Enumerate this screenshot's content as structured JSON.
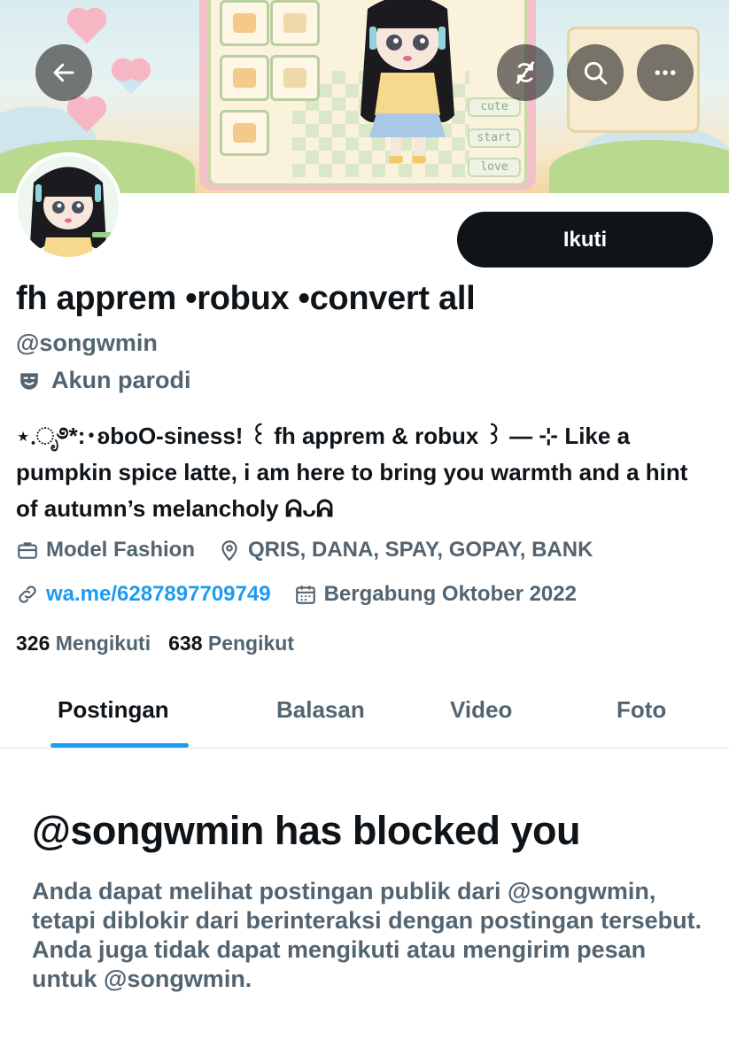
{
  "header": {
    "back_icon": "arrow-left-icon",
    "sync_icon": "no-sync-icon",
    "search_icon": "search-icon",
    "more_icon": "more-horizontal-icon",
    "banner_tags": [
      "cute",
      "start",
      "love"
    ]
  },
  "profile": {
    "follow_label": "Ikuti",
    "name": "fh apprem •robux •convert all",
    "handle": "@songwmin",
    "parody_label": "Akun parodi",
    "bio": "⋆.ೃ࿔*:･ʚboO-siness! ꒰ fh apprem & robux ꒱ — ⊹ Like a pumpkin spice latte, i am here to bring you warmth and a hint of autumn’s melancholy ᕱᴗᕱ",
    "category": "Model Fashion",
    "location": "QRIS, DANA, SPAY, GOPAY, BANK",
    "website": "wa.me/6287897709749",
    "joined": "Bergabung Oktober 2022",
    "following_count": "326",
    "following_label": "Mengikuti",
    "followers_count": "638",
    "followers_label": "Pengikut"
  },
  "tabs": [
    {
      "label": "Postingan",
      "active": true
    },
    {
      "label": "Balasan",
      "active": false
    },
    {
      "label": "Video",
      "active": false
    },
    {
      "label": "Foto",
      "active": false
    }
  ],
  "blocked": {
    "title": "@songwmin has blocked you",
    "message": "Anda dapat melihat postingan publik dari @songwmin, tetapi diblokir dari berinteraksi dengan postingan tersebut. Anda juga tidak dapat mengikuti atau mengirim pesan untuk @songwmin."
  },
  "colors": {
    "accent": "#1d9bf0",
    "text_primary": "#0f1419",
    "text_secondary": "#536471",
    "button_dark": "#0f1419"
  }
}
